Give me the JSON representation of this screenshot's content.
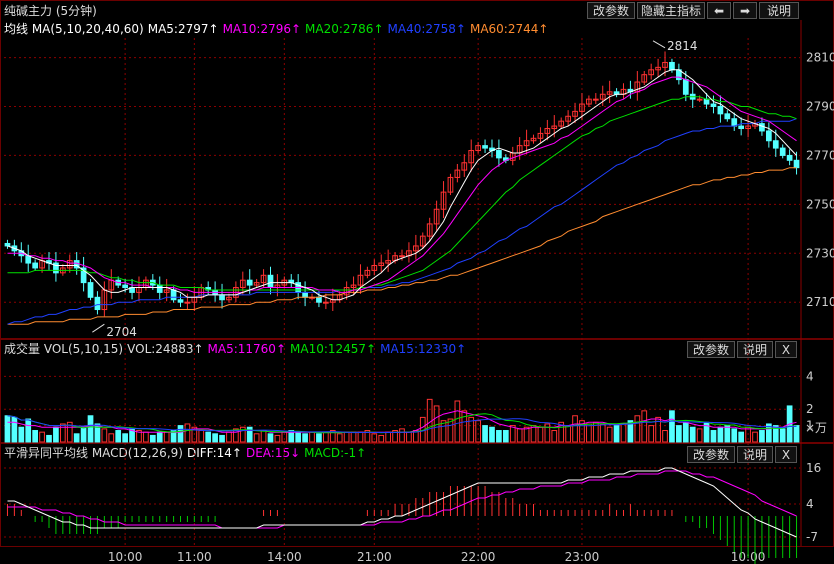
{
  "toolbar": {
    "edit_params": "改参数",
    "hide_indicator": "隐藏主指标",
    "prev_arrow": "⬅",
    "next_arrow": "➡",
    "help": "说明",
    "close": "X"
  },
  "title": "纯碱主力 (5分钟)",
  "colors": {
    "up": "#ff3232",
    "down": "#54ffff",
    "ma5": "#ffffff",
    "ma10": "#ff00ff",
    "ma20": "#00e000",
    "ma40": "#2040ff",
    "ma60": "#ff8c30",
    "grid": "#8b0000",
    "axis_text": "#ccc"
  },
  "price_panel": {
    "legend": [
      {
        "text": "均线 MA(5,10,20,40,60)",
        "color": "#ffffff"
      },
      {
        "text": "MA5:2797↑",
        "color": "#ffffff"
      },
      {
        "text": "MA10:2796↑",
        "color": "#ff00ff"
      },
      {
        "text": "MA20:2786↑",
        "color": "#00e000"
      },
      {
        "text": "MA40:2758↑",
        "color": "#2040ff"
      },
      {
        "text": "MA60:2744↑",
        "color": "#ff8c30"
      }
    ],
    "y_ticks": [
      "2810",
      "2790",
      "2770",
      "2750",
      "2730",
      "2710"
    ],
    "annotations": [
      {
        "label": "2814"
      },
      {
        "label": "2704"
      }
    ]
  },
  "volume_panel": {
    "legend": [
      {
        "text": "成交量 VOL(5,10,15)",
        "color": "#dddddd"
      },
      {
        "text": "VOL:24883↑",
        "color": "#dddddd"
      },
      {
        "text": "MA5:11760↑",
        "color": "#ff00ff"
      },
      {
        "text": "MA10:12457↑",
        "color": "#00e000"
      },
      {
        "text": "MA15:12330↑",
        "color": "#2040ff"
      }
    ],
    "y_ticks": [
      "4",
      "2",
      "1"
    ],
    "unit": "×万"
  },
  "macd_panel": {
    "legend": [
      {
        "text": "平滑异同平均线 MACD(12,26,9)",
        "color": "#dddddd"
      },
      {
        "text": "DIFF:14↑",
        "color": "#ffffff"
      },
      {
        "text": "DEA:15↓",
        "color": "#ff00ff"
      },
      {
        "text": "MACD:-1↑",
        "color": "#00e000"
      }
    ],
    "y_ticks": [
      "16",
      "4",
      "-7"
    ]
  },
  "x_axis": [
    "10:00",
    "11:00",
    "14:00",
    "21:00",
    "22:00",
    "23:00",
    "10:00"
  ],
  "chart_data": {
    "type": "candlestick",
    "title": "纯碱主力 (5分钟)",
    "x_tick_labels": [
      "10:00",
      "11:00",
      "14:00",
      "21:00",
      "22:00",
      "23:00",
      "10:00"
    ],
    "price_ylim": [
      2697,
      2818
    ],
    "price_ticks": [
      2810,
      2790,
      2770,
      2750,
      2730,
      2710
    ],
    "closes": [
      2733,
      2731,
      2729,
      2726,
      2724,
      2727,
      2726,
      2722,
      2724,
      2727,
      2724,
      2718,
      2712,
      2707,
      2715,
      2719,
      2717,
      2716,
      2714,
      2716,
      2719,
      2717,
      2714,
      2715,
      2711,
      2710,
      2710,
      2712,
      2716,
      2715,
      2713,
      2711,
      2712,
      2716,
      2719,
      2717,
      2718,
      2721,
      2716,
      2717,
      2719,
      2718,
      2714,
      2712,
      2712,
      2710,
      2710,
      2711,
      2713,
      2716,
      2717,
      2721,
      2723,
      2725,
      2726,
      2727,
      2729,
      2729,
      2731,
      2733,
      2737,
      2742,
      2748,
      2755,
      2761,
      2764,
      2767,
      2772,
      2774,
      2773,
      2772,
      2769,
      2768,
      2771,
      2774,
      2776,
      2777,
      2779,
      2781,
      2782,
      2784,
      2786,
      2788,
      2791,
      2793,
      2793,
      2795,
      2796,
      2795,
      2797,
      2796,
      2800,
      2803,
      2805,
      2806,
      2808,
      2805,
      2801,
      2795,
      2793,
      2793,
      2791,
      2790,
      2787,
      2785,
      2782,
      2781,
      2782,
      2783,
      2780,
      2776,
      2773,
      2770,
      2768,
      2765
    ],
    "ma5": [
      2733,
      2732,
      2731,
      2729,
      2728,
      2727,
      2726,
      2725,
      2725,
      2725,
      2725,
      2723,
      2721,
      2718,
      2715,
      2714,
      2714,
      2715,
      2716,
      2716,
      2716,
      2716,
      2716,
      2716,
      2715,
      2714,
      2712,
      2712,
      2712,
      2713,
      2713,
      2713,
      2713,
      2713,
      2714,
      2715,
      2716,
      2717,
      2718,
      2718,
      2718,
      2718,
      2717,
      2716,
      2715,
      2713,
      2712,
      2711,
      2711,
      2712,
      2713,
      2716,
      2718,
      2720,
      2722,
      2725,
      2727,
      2728,
      2729,
      2730,
      2732,
      2735,
      2739,
      2743,
      2749,
      2754,
      2759,
      2764,
      2768,
      2770,
      2772,
      2773,
      2772,
      2771,
      2771,
      2772,
      2773,
      2775,
      2777,
      2779,
      2781,
      2782,
      2784,
      2786,
      2788,
      2790,
      2792,
      2794,
      2795,
      2795,
      2796,
      2797,
      2798,
      2800,
      2802,
      2804,
      2805,
      2805,
      2803,
      2801,
      2798,
      2795,
      2792,
      2791,
      2789,
      2787,
      2785,
      2784,
      2783,
      2782,
      2781,
      2779,
      2776,
      2773,
      2770
    ],
    "ma10": [
      2730,
      2730,
      2730,
      2729,
      2729,
      2728,
      2728,
      2727,
      2727,
      2726,
      2726,
      2725,
      2724,
      2722,
      2720,
      2719,
      2718,
      2718,
      2717,
      2717,
      2717,
      2716,
      2716,
      2716,
      2716,
      2715,
      2715,
      2714,
      2714,
      2714,
      2714,
      2714,
      2714,
      2714,
      2714,
      2715,
      2715,
      2716,
      2716,
      2716,
      2716,
      2716,
      2716,
      2716,
      2716,
      2715,
      2715,
      2715,
      2714,
      2714,
      2715,
      2715,
      2716,
      2717,
      2718,
      2719,
      2721,
      2723,
      2725,
      2727,
      2729,
      2732,
      2735,
      2738,
      2742,
      2746,
      2750,
      2754,
      2758,
      2761,
      2764,
      2766,
      2768,
      2769,
      2770,
      2771,
      2772,
      2773,
      2774,
      2775,
      2777,
      2778,
      2780,
      2782,
      2784,
      2786,
      2788,
      2790,
      2792,
      2793,
      2795,
      2796,
      2797,
      2799,
      2800,
      2801,
      2802,
      2802,
      2801,
      2800,
      2799,
      2798,
      2796,
      2794,
      2792,
      2790,
      2788,
      2787,
      2786,
      2785,
      2784,
      2782,
      2780,
      2778,
      2776
    ],
    "ma20": [
      2722,
      2722,
      2722,
      2722,
      2723,
      2723,
      2723,
      2723,
      2723,
      2723,
      2723,
      2723,
      2722,
      2722,
      2721,
      2720,
      2720,
      2719,
      2719,
      2718,
      2718,
      2718,
      2717,
      2717,
      2717,
      2716,
      2716,
      2716,
      2716,
      2715,
      2715,
      2715,
      2715,
      2715,
      2715,
      2715,
      2715,
      2715,
      2715,
      2715,
      2715,
      2715,
      2715,
      2715,
      2715,
      2715,
      2715,
      2715,
      2715,
      2715,
      2715,
      2716,
      2716,
      2717,
      2717,
      2718,
      2719,
      2720,
      2721,
      2722,
      2723,
      2725,
      2727,
      2729,
      2731,
      2734,
      2737,
      2740,
      2743,
      2746,
      2749,
      2752,
      2755,
      2757,
      2760,
      2762,
      2764,
      2766,
      2768,
      2770,
      2772,
      2774,
      2776,
      2778,
      2779,
      2781,
      2782,
      2784,
      2785,
      2786,
      2787,
      2788,
      2789,
      2790,
      2791,
      2792,
      2793,
      2793,
      2794,
      2794,
      2794,
      2793,
      2793,
      2792,
      2792,
      2791,
      2790,
      2790,
      2789,
      2788,
      2787,
      2787,
      2786,
      2786,
      2785
    ],
    "ma40": [
      2701,
      2702,
      2702,
      2703,
      2704,
      2704,
      2705,
      2705,
      2706,
      2707,
      2707,
      2708,
      2708,
      2709,
      2709,
      2709,
      2710,
      2710,
      2710,
      2711,
      2711,
      2711,
      2711,
      2712,
      2712,
      2712,
      2712,
      2712,
      2713,
      2713,
      2713,
      2713,
      2713,
      2713,
      2713,
      2713,
      2714,
      2714,
      2714,
      2714,
      2714,
      2714,
      2714,
      2714,
      2714,
      2714,
      2714,
      2714,
      2715,
      2715,
      2715,
      2715,
      2716,
      2716,
      2716,
      2717,
      2717,
      2718,
      2718,
      2719,
      2720,
      2721,
      2722,
      2723,
      2724,
      2726,
      2727,
      2728,
      2730,
      2731,
      2733,
      2735,
      2736,
      2738,
      2740,
      2741,
      2743,
      2745,
      2747,
      2749,
      2750,
      2752,
      2754,
      2756,
      2758,
      2760,
      2762,
      2764,
      2766,
      2767,
      2769,
      2770,
      2772,
      2773,
      2774,
      2776,
      2777,
      2778,
      2779,
      2780,
      2780,
      2781,
      2781,
      2782,
      2782,
      2782,
      2783,
      2783,
      2783,
      2784,
      2784,
      2784,
      2784,
      2784,
      2785
    ],
    "ma60": [
      2701,
      2701,
      2701,
      2701,
      2702,
      2702,
      2702,
      2702,
      2702,
      2703,
      2703,
      2703,
      2703,
      2704,
      2704,
      2704,
      2704,
      2705,
      2705,
      2705,
      2705,
      2706,
      2706,
      2706,
      2707,
      2707,
      2707,
      2707,
      2708,
      2708,
      2708,
      2708,
      2709,
      2709,
      2709,
      2709,
      2710,
      2710,
      2710,
      2711,
      2711,
      2711,
      2712,
      2712,
      2712,
      2712,
      2713,
      2713,
      2713,
      2714,
      2714,
      2714,
      2715,
      2715,
      2715,
      2716,
      2716,
      2717,
      2717,
      2718,
      2718,
      2719,
      2719,
      2720,
      2721,
      2721,
      2722,
      2723,
      2724,
      2725,
      2726,
      2727,
      2728,
      2729,
      2730,
      2731,
      2732,
      2733,
      2735,
      2736,
      2737,
      2739,
      2740,
      2741,
      2742,
      2743,
      2745,
      2746,
      2747,
      2748,
      2749,
      2750,
      2751,
      2752,
      2753,
      2754,
      2755,
      2756,
      2757,
      2758,
      2758,
      2759,
      2760,
      2760,
      2761,
      2761,
      2762,
      2762,
      2763,
      2763,
      2764,
      2764,
      2764,
      2765,
      2765
    ],
    "volume_ylim": [
      0,
      5
    ],
    "volume_ticks": [
      4,
      2,
      1
    ],
    "volumes": [
      1.6,
      1.5,
      0.9,
      1.4,
      0.7,
      0.6,
      0.4,
      0.9,
      1.1,
      1.2,
      0.5,
      0.9,
      1.6,
      1.1,
      0.8,
      0.5,
      0.7,
      0.5,
      0.8,
      0.7,
      0.6,
      0.4,
      0.6,
      0.6,
      0.7,
      1.0,
      1.1,
      0.9,
      0.7,
      0.6,
      0.5,
      0.4,
      0.6,
      0.8,
      0.9,
      0.9,
      0.5,
      0.7,
      0.5,
      0.4,
      0.6,
      0.7,
      0.6,
      0.5,
      0.6,
      0.5,
      0.6,
      0.7,
      0.5,
      0.6,
      0.6,
      0.6,
      0.7,
      0.5,
      0.4,
      0.6,
      0.7,
      0.8,
      0.6,
      0.7,
      1.5,
      2.6,
      2.2,
      1.3,
      1.4,
      2.5,
      1.9,
      1.5,
      1.3,
      1.0,
      0.9,
      0.7,
      0.7,
      1.0,
      0.8,
      0.9,
      1.0,
      0.9,
      1.1,
      0.7,
      1.2,
      1.0,
      1.6,
      1.3,
      1.1,
      1.2,
      1.1,
      0.9,
      1.0,
      1.1,
      1.3,
      1.6,
      1.9,
      1.0,
      1.5,
      0.7,
      1.9,
      1.0,
      1.2,
      0.9,
      0.8,
      1.2,
      0.7,
      0.9,
      1.0,
      0.8,
      0.6,
      0.9,
      0.6,
      0.7,
      1.1,
      1.0,
      0.8,
      2.2,
      1.0
    ],
    "vol_ma5": [
      1.2,
      1.2,
      1.1,
      1.0,
      1.0,
      0.9,
      0.9,
      0.9,
      0.9,
      0.9,
      0.9,
      0.9,
      1.0,
      1.0,
      0.9,
      0.9,
      0.8,
      0.8,
      0.7,
      0.6,
      0.6,
      0.6,
      0.6,
      0.6,
      0.6,
      0.6,
      0.7,
      0.8,
      0.8,
      0.8,
      0.7,
      0.6,
      0.6,
      0.6,
      0.7,
      0.7,
      0.7,
      0.7,
      0.6,
      0.6,
      0.6,
      0.6,
      0.6,
      0.6,
      0.6,
      0.6,
      0.6,
      0.6,
      0.6,
      0.6,
      0.6,
      0.6,
      0.6,
      0.6,
      0.6,
      0.6,
      0.6,
      0.6,
      0.6,
      0.7,
      0.9,
      1.2,
      1.5,
      1.7,
      1.8,
      1.9,
      1.8,
      1.7,
      1.6,
      1.5,
      1.3,
      1.1,
      1.0,
      0.9,
      0.8,
      0.8,
      0.9,
      0.9,
      0.9,
      0.9,
      1.0,
      1.0,
      1.1,
      1.1,
      1.2,
      1.2,
      1.2,
      1.1,
      1.1,
      1.1,
      1.1,
      1.2,
      1.3,
      1.4,
      1.4,
      1.3,
      1.4,
      1.2,
      1.2,
      1.1,
      1.0,
      1.0,
      0.9,
      0.9,
      0.9,
      0.9,
      0.8,
      0.8,
      0.8,
      0.8,
      0.8,
      0.9,
      0.9,
      1.1,
      1.2
    ],
    "macd_ylim": [
      -10,
      18
    ],
    "macd_ticks": [
      16,
      4,
      -7
    ],
    "diff": [
      5,
      5,
      4,
      3,
      2,
      1,
      0,
      -1,
      -2,
      -2,
      -3,
      -3,
      -4,
      -4,
      -4,
      -4,
      -4,
      -4,
      -4,
      -4,
      -4,
      -4,
      -4,
      -4,
      -4,
      -4,
      -4,
      -4,
      -4,
      -4,
      -4,
      -4,
      -4,
      -4,
      -4,
      -4,
      -4,
      -3,
      -3,
      -3,
      -3,
      -3,
      -3,
      -3,
      -3,
      -3,
      -3,
      -3,
      -3,
      -3,
      -3,
      -3,
      -2,
      -2,
      -1,
      -1,
      0,
      0,
      1,
      2,
      3,
      4,
      5,
      6,
      7,
      8,
      9,
      10,
      11,
      11,
      11,
      11,
      11,
      11,
      11,
      11,
      11,
      11,
      11,
      11,
      11,
      12,
      12,
      12,
      13,
      13,
      13,
      14,
      14,
      14,
      15,
      15,
      15,
      15,
      15,
      16,
      16,
      15,
      14,
      13,
      12,
      11,
      10,
      8,
      6,
      4,
      2,
      1,
      -1,
      -2,
      -3,
      -4,
      -5,
      -6,
      -7
    ],
    "dea": [
      3,
      3,
      3,
      3,
      3,
      2,
      2,
      2,
      1,
      1,
      0,
      0,
      -1,
      -1,
      -2,
      -2,
      -2,
      -3,
      -3,
      -3,
      -3,
      -3,
      -3,
      -3,
      -3,
      -3,
      -3,
      -3,
      -3,
      -3,
      -3,
      -4,
      -4,
      -4,
      -4,
      -4,
      -4,
      -4,
      -4,
      -4,
      -3,
      -3,
      -3,
      -3,
      -3,
      -3,
      -3,
      -3,
      -3,
      -3,
      -3,
      -3,
      -3,
      -3,
      -2,
      -2,
      -2,
      -2,
      -1,
      -1,
      0,
      0,
      1,
      2,
      2,
      3,
      4,
      5,
      6,
      6,
      7,
      7,
      8,
      8,
      9,
      9,
      9,
      10,
      10,
      10,
      10,
      11,
      11,
      11,
      12,
      12,
      12,
      12,
      13,
      13,
      13,
      14,
      14,
      14,
      14,
      15,
      15,
      15,
      15,
      14,
      14,
      13,
      13,
      12,
      11,
      10,
      9,
      8,
      7,
      5,
      4,
      3,
      2,
      1,
      0
    ],
    "macd_hist_note": "histogram = diff - dea"
  }
}
